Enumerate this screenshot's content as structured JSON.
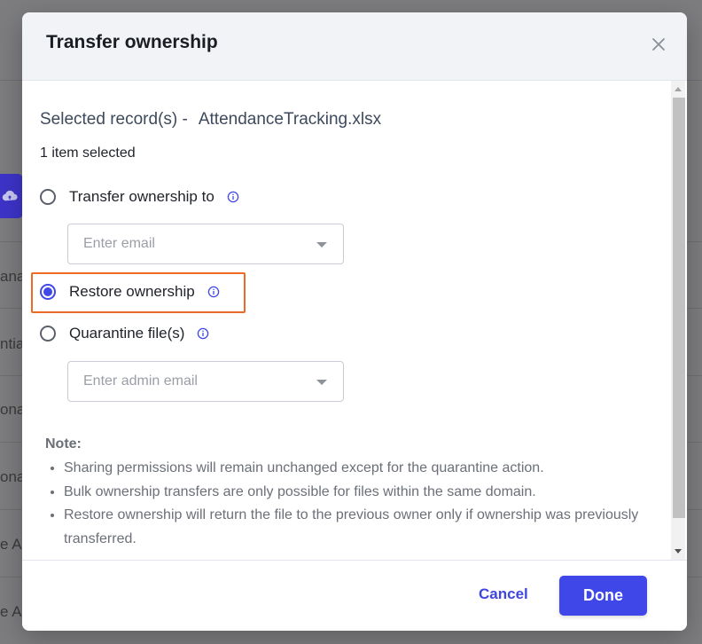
{
  "background": {
    "fragments": [
      "ana",
      "ntia",
      "ona",
      "ona",
      "e A",
      "e A"
    ]
  },
  "dialog": {
    "title": "Transfer ownership",
    "close_icon": "close-icon",
    "selected_label": "Selected record(s) -",
    "selected_file": "AttendanceTracking.xlsx",
    "items_selected": "1 item selected",
    "options": [
      {
        "label": "Transfer ownership to",
        "checked": false
      },
      {
        "label": "Restore ownership",
        "checked": true
      },
      {
        "label": "Quarantine file(s)",
        "checked": false
      }
    ],
    "email_placeholder": "Enter email",
    "admin_email_placeholder": "Enter admin email",
    "note_title": "Note:",
    "notes": [
      "Sharing permissions will remain unchanged except for the quarantine action.",
      "Bulk ownership transfers are only possible for files within the same domain.",
      "Restore ownership will return the file to the previous owner only if ownership was previously transferred."
    ],
    "cancel_label": "Cancel",
    "done_label": "Done"
  },
  "colors": {
    "accent": "#3f47e8",
    "highlight": "#ec6a25",
    "overlay": "#7d7d7f"
  }
}
